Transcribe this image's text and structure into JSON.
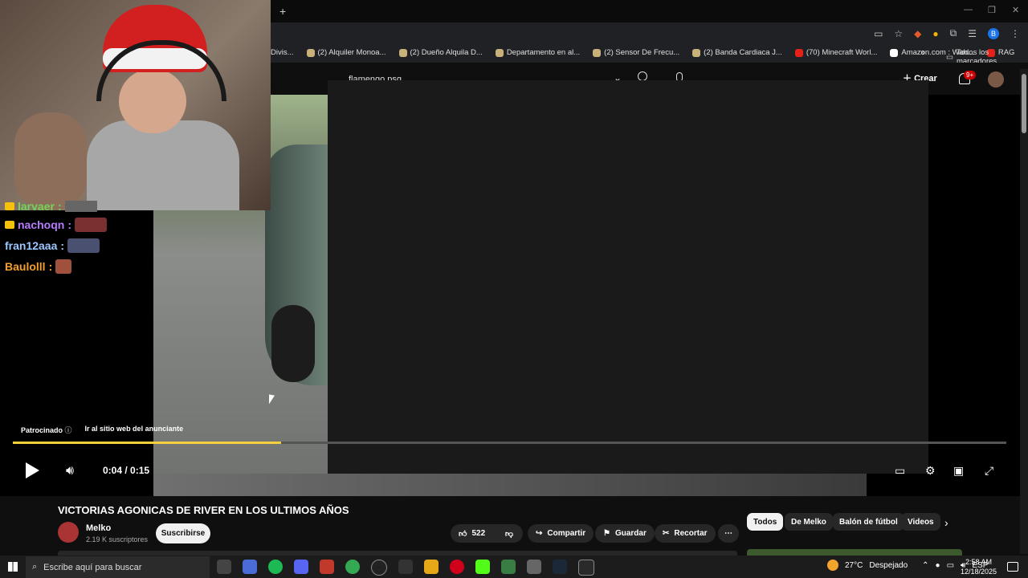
{
  "browser": {
    "new_tab_glyph": "+",
    "window_controls": [
      "—",
      "❐",
      "✕"
    ],
    "profile_initial": "B",
    "bookmarks": [
      {
        "label": "Divis...",
        "icon": "bookmark-icon"
      },
      {
        "label": "(2) Alquiler Monoa...",
        "icon": "bookmark-icon"
      },
      {
        "label": "(2) Dueño Alquila D...",
        "icon": "bookmark-icon"
      },
      {
        "label": "Departamento en al...",
        "icon": "bookmark-icon"
      },
      {
        "label": "(2) Sensor De Frecu...",
        "icon": "bookmark-icon"
      },
      {
        "label": "(2) Banda Cardiaca J...",
        "icon": "bookmark-icon"
      },
      {
        "label": "(70) Minecraft Worl...",
        "icon": "youtube-icon"
      },
      {
        "label": "Amazon.com : Wah...",
        "icon": "amazon-icon"
      },
      {
        "label": "RAG",
        "icon": "youtube-icon"
      }
    ],
    "bookmarks_more": "»",
    "all_bookmarks": "Todos los marcadores"
  },
  "youtube": {
    "search_query": "flamengo psg",
    "create_label": "Crear",
    "notifications_badge": "9+"
  },
  "chat": [
    {
      "name": "larvaer",
      "separator": ":",
      "color": "#74d45a",
      "badge": "crown-icon"
    },
    {
      "name": "nachoqn",
      "separator": ":",
      "color": "#b67bff",
      "badge": "crown-icon"
    },
    {
      "name": "fran12aaa",
      "separator": ":",
      "color": "#9dc7ff",
      "badge": ""
    },
    {
      "name": "Baulolll",
      "separator": ":",
      "color": "#f3a02b",
      "badge": ""
    }
  ],
  "player": {
    "sponsored_label": "Patrocinado",
    "advertiser_link": "Ir al sitio web del anunciante",
    "time": "0:04 / 0:15",
    "progress_fraction": 0.27,
    "accent_color": "#f4d03f"
  },
  "video": {
    "title": "VICTORIAS AGONICAS DE RIVER EN LOS ULTIMOS AÑOS",
    "channel_name": "Melko",
    "channel_subs": "2.19 K suscriptores",
    "subscribe_label": "Suscribirse",
    "likes": "522",
    "share_label": "Compartir",
    "save_label": "Guardar",
    "clip_label": "Recortar"
  },
  "chips": [
    "Todos",
    "De Melko",
    "Balón de fútbol",
    "Videos"
  ],
  "taskbar": {
    "search_placeholder": "Escribe aquí para buscar",
    "temperature": "27°C",
    "weather": "Despejado",
    "language": "ESP",
    "time": "2:58 AM",
    "date": "12/18/2025"
  }
}
